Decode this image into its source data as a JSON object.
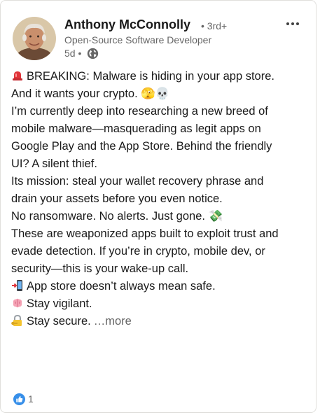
{
  "post": {
    "author": {
      "name": "Anthony McConnolly",
      "degree": "• 3rd+",
      "headline": "Open-Source Software Developer",
      "time": "5d",
      "separator": "•",
      "visibility_icon": "globe-icon",
      "avatar": "profile-photo"
    },
    "menu_icon": "more-options-icon",
    "body_lines": [
      {
        "icon": "siren-icon",
        "text": "BREAKING: Malware is hiding in your app store."
      },
      {
        "text": " And it wants your crypto. 🫣💀"
      },
      {
        "text": "I’m currently deep into researching a new breed of"
      },
      {
        "text": "mobile malware—masquerading as legit apps on"
      },
      {
        "text": "Google Play and the App Store. Behind the friendly"
      },
      {
        "text": "UI? A silent thief."
      },
      {
        "text": "Its mission: steal your wallet recovery phrase and"
      },
      {
        "text": "drain your assets before you even notice."
      },
      {
        "text": " No ransomware. No alerts. Just gone. 💸"
      },
      {
        "text": "These are weaponized apps built to exploit trust and"
      },
      {
        "text": "evade detection. If you’re in crypto, mobile dev, or"
      },
      {
        "text": "security—this is your wake-up call."
      },
      {
        "icon": "mobile-arrow-icon",
        "text": "App store doesn’t always mean safe."
      },
      {
        "icon": "brain-icon",
        "text": "Stay vigilant."
      },
      {
        "icon": "lock-key-icon",
        "text": "Stay secure."
      }
    ],
    "see_more": "…more",
    "reactions": {
      "icon": "like-icon",
      "count": "1"
    }
  },
  "colors": {
    "text": "#191919",
    "secondary": "#666666",
    "like_blue": "#378fe9",
    "border": "#e0dfdc"
  }
}
